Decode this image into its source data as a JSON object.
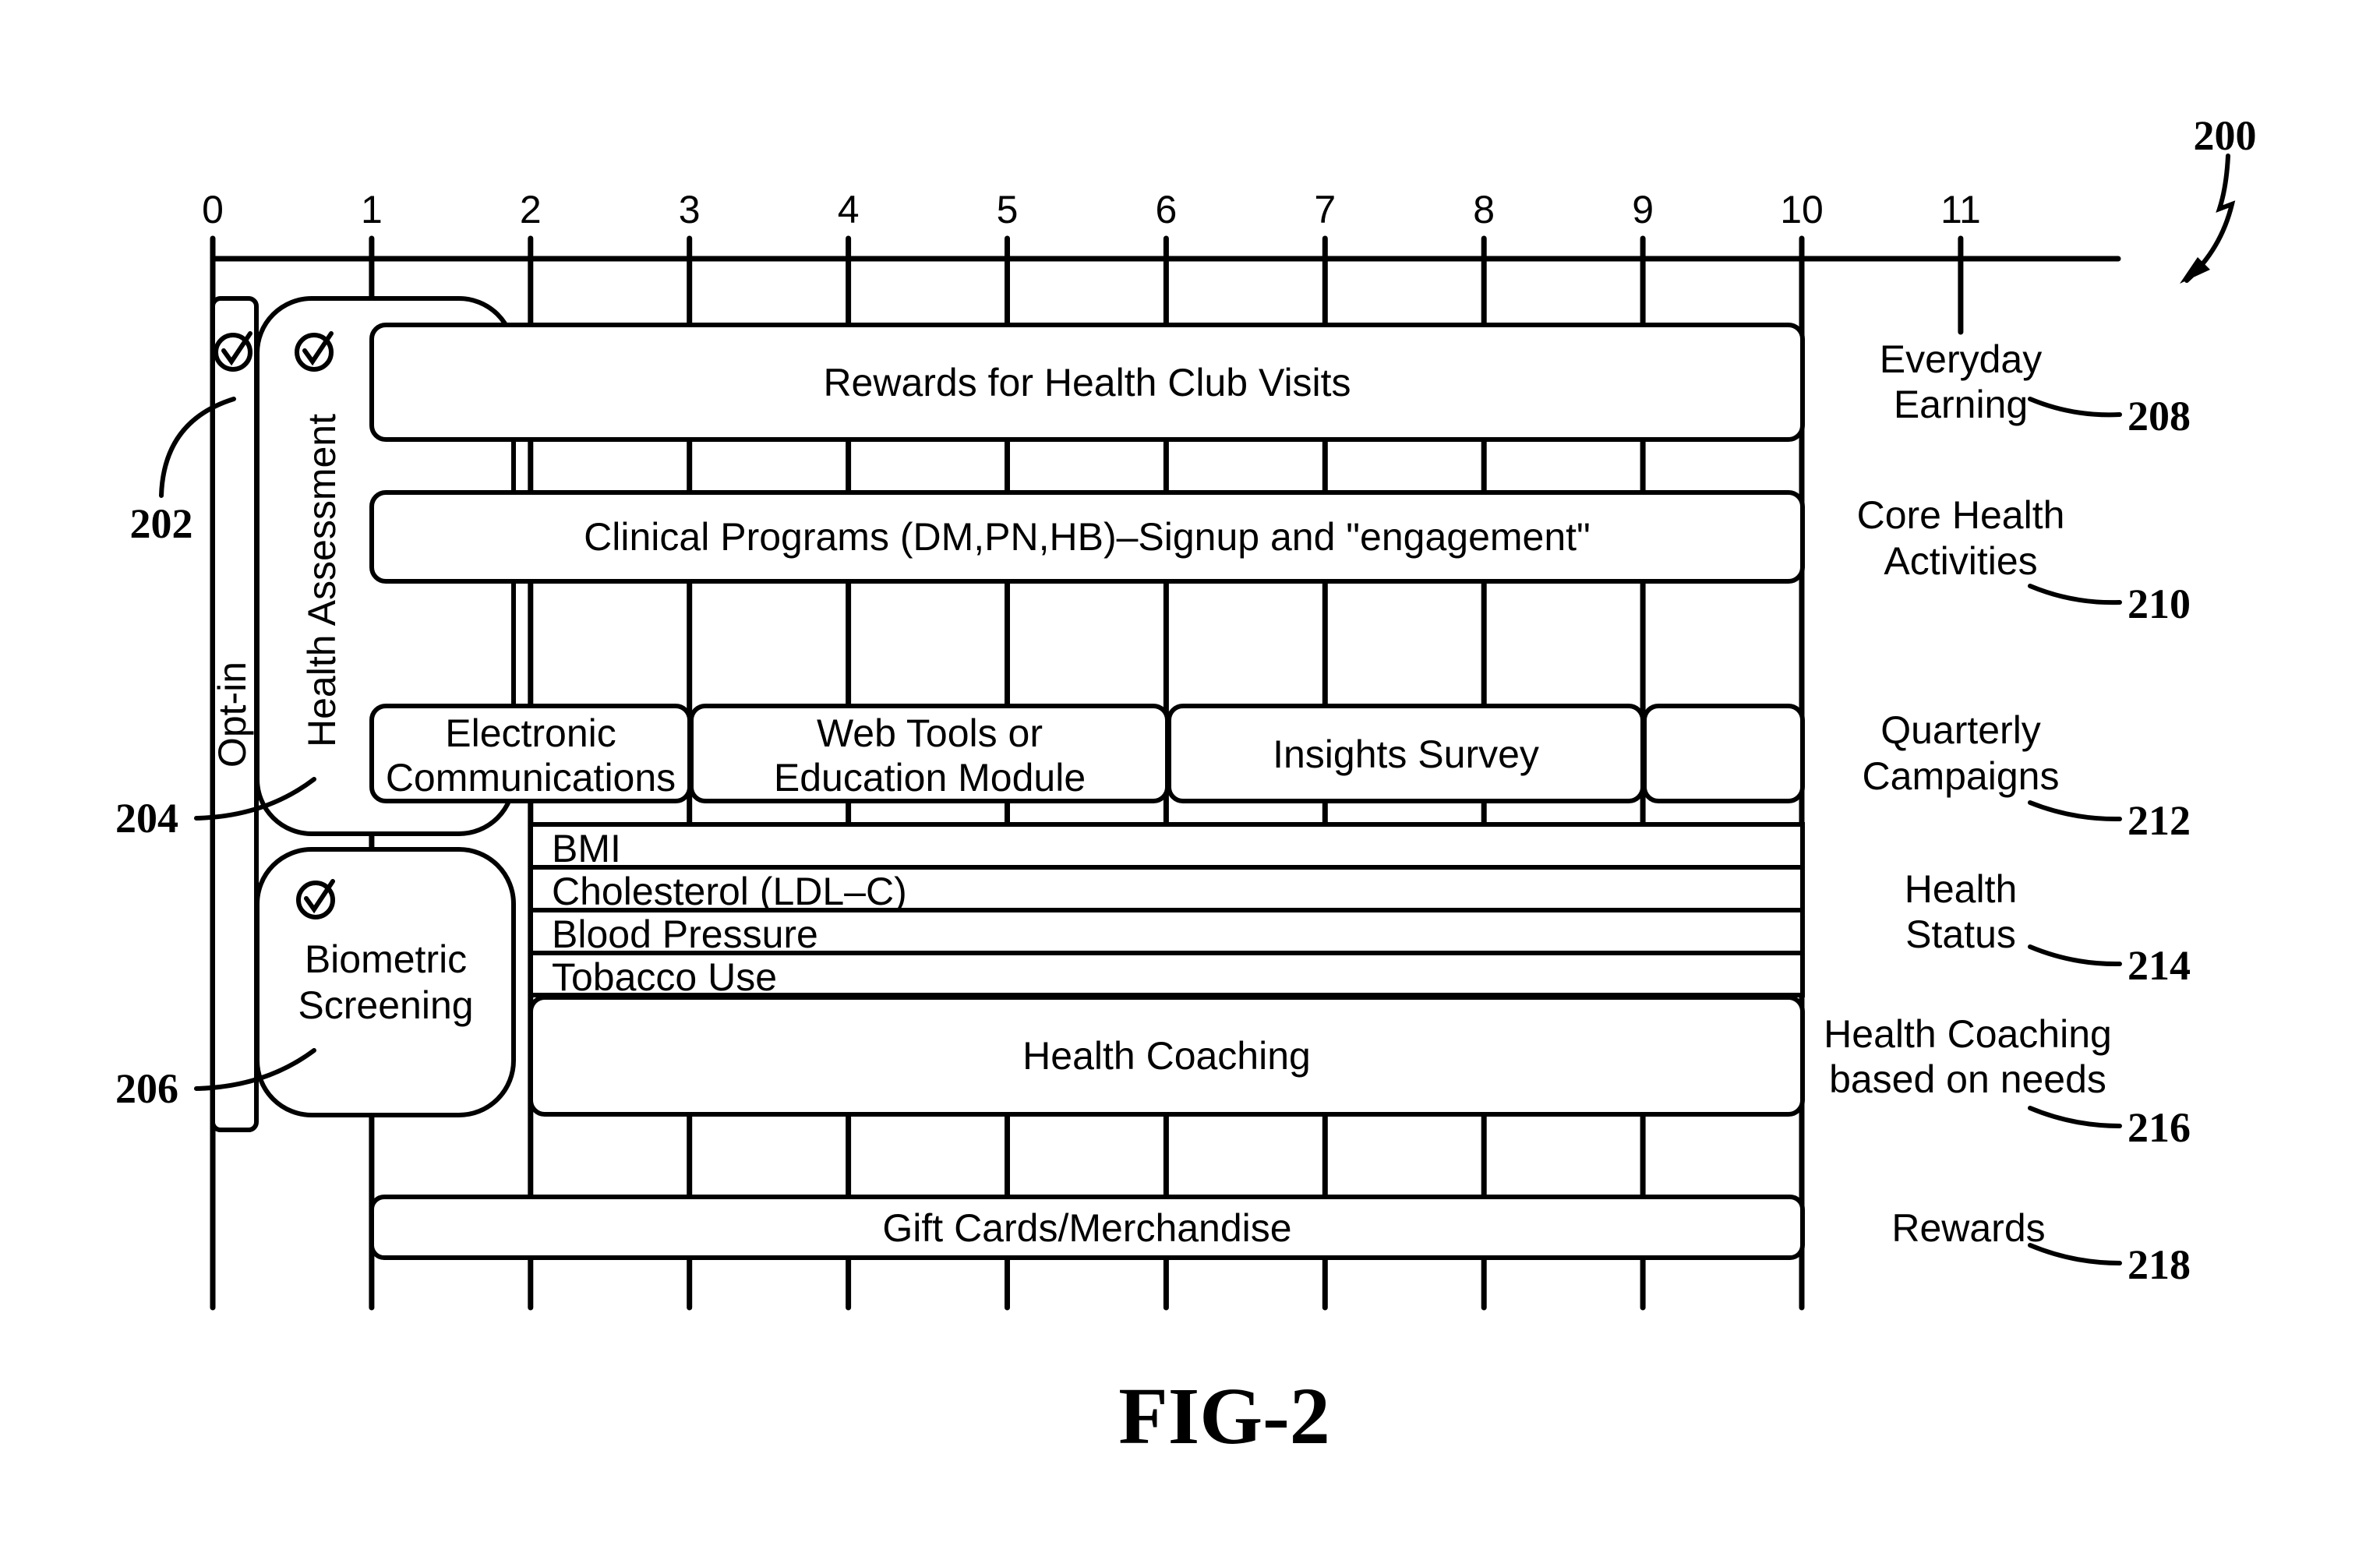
{
  "figure": {
    "reference_number": "200",
    "caption": "FIG-2",
    "axis_ticks": [
      "0",
      "1",
      "2",
      "3",
      "4",
      "5",
      "6",
      "7",
      "8",
      "9",
      "10",
      "11"
    ]
  },
  "left_column": {
    "opt_in": {
      "label": "Opt-in",
      "checked": true,
      "ref": "202"
    },
    "health_assessment": {
      "label": "Health Assessment",
      "checked": true,
      "ref": "204"
    },
    "biometric_screening": {
      "label_lines": [
        "Biometric",
        "Screening"
      ],
      "checked": true,
      "ref": "206"
    }
  },
  "rows": {
    "everyday_earning": {
      "bar_label": "Rewards for Health Club Visits",
      "category_lines": [
        "Everyday",
        "Earning"
      ],
      "ref": "208"
    },
    "core_health": {
      "bar_label": "Clinical Programs (DM,PN,HB)–Signup and \"engagement\"",
      "category_lines": [
        "Core Health",
        "Activities"
      ],
      "ref": "210"
    },
    "quarterly": {
      "boxes": [
        {
          "lines": [
            "Electronic",
            "Communications"
          ]
        },
        {
          "lines": [
            "Web Tools or",
            "Education Module"
          ]
        },
        {
          "lines": [
            "Insights Survey"
          ]
        },
        {
          "lines": []
        }
      ],
      "category_lines": [
        "Quarterly",
        "Campaigns"
      ],
      "ref": "212"
    },
    "health_status": {
      "items": [
        "BMI",
        "Cholesterol (LDL–C)",
        "Blood Pressure",
        "Tobacco Use"
      ],
      "category_lines": [
        "Health",
        "Status"
      ],
      "ref": "214"
    },
    "health_coaching": {
      "bar_label": "Health Coaching",
      "category_lines": [
        "Health Coaching",
        "based on needs"
      ],
      "ref": "216"
    },
    "rewards": {
      "bar_label": "Gift Cards/Merchandise",
      "category_lines": [
        "Rewards"
      ],
      "ref": "218"
    }
  }
}
